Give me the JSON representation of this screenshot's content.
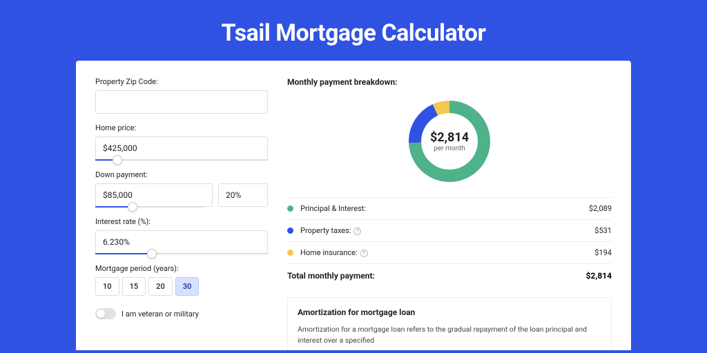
{
  "title": "Tsail Mortgage Calculator",
  "form": {
    "zip_label": "Property Zip Code:",
    "zip_value": "",
    "price_label": "Home price:",
    "price_value": "$425,000",
    "down_label": "Down payment:",
    "down_value": "$85,000",
    "down_pct": "20%",
    "rate_label": "Interest rate (%):",
    "rate_value": "6.230%",
    "period_label": "Mortgage period (years):",
    "periods": [
      "10",
      "15",
      "20",
      "30"
    ],
    "period_active": "30",
    "veteran_label": "I am veteran or military"
  },
  "breakdown": {
    "title": "Monthly payment breakdown:",
    "center_amount": "$2,814",
    "center_sub": "per month",
    "items": [
      {
        "label": "Principal & Interest:",
        "value": "$2,089",
        "color": "#4eb28b"
      },
      {
        "label": "Property taxes:",
        "value": "$531",
        "color": "#3052e3",
        "info": true
      },
      {
        "label": "Home insurance:",
        "value": "$194",
        "color": "#f3c94f",
        "info": true
      }
    ],
    "total_label": "Total monthly payment:",
    "total_value": "$2,814"
  },
  "amort": {
    "title": "Amortization for mortgage loan",
    "text": "Amortization for a mortgage loan refers to the gradual repayment of the loan principal and interest over a specified"
  },
  "chart_data": {
    "type": "pie",
    "title": "Monthly payment breakdown",
    "series": [
      {
        "name": "Principal & Interest",
        "value": 2089,
        "color": "#4eb28b"
      },
      {
        "name": "Property taxes",
        "value": 531,
        "color": "#3052e3"
      },
      {
        "name": "Home insurance",
        "value": 194,
        "color": "#f3c94f"
      }
    ],
    "total": 2814,
    "center_label": "$2,814 per month"
  },
  "colors": {
    "accent": "#3052e3",
    "green": "#4eb28b",
    "yellow": "#f3c94f"
  }
}
